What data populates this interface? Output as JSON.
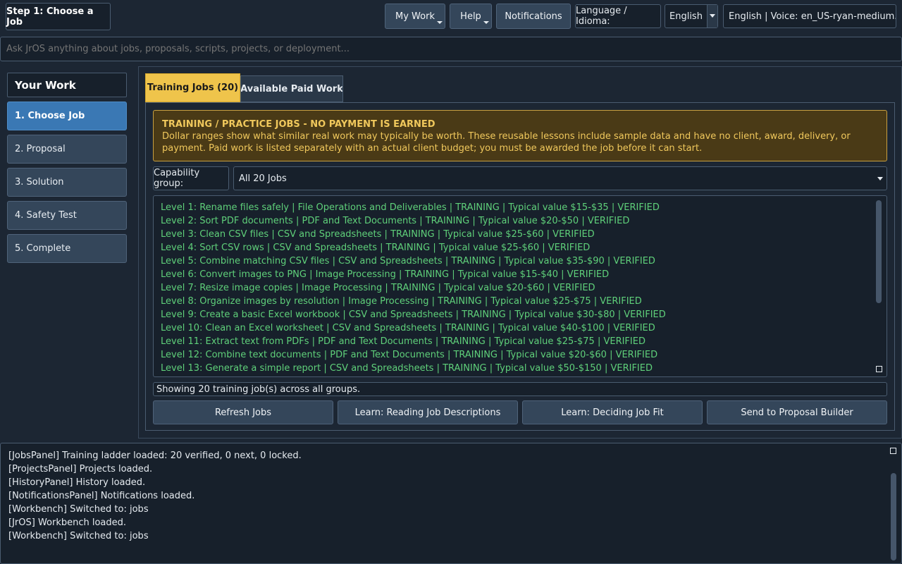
{
  "header": {
    "step_title": "Step 1: Choose a Job",
    "my_work_label": "My Work",
    "help_label": "Help",
    "notifications_label": "Notifications",
    "language_label": "Language / Idioma:",
    "language_value": "English",
    "voice_label": "English | Voice: en_US-ryan-medium.onnx"
  },
  "search": {
    "placeholder": "Ask JrOS anything about jobs, proposals, scripts, projects, or deployment..."
  },
  "sidebar": {
    "title": "Your Work",
    "items": [
      {
        "label": "1. Choose Job",
        "active": true
      },
      {
        "label": "2. Proposal"
      },
      {
        "label": "3. Solution"
      },
      {
        "label": "4. Safety Test"
      },
      {
        "label": "5. Complete"
      }
    ]
  },
  "tabs": {
    "training": "Training Jobs (20)",
    "paid": "Available Paid Work"
  },
  "warning": {
    "title": "TRAINING / PRACTICE JOBS - NO PAYMENT IS EARNED",
    "body": "Dollar ranges show what similar real work may typically be worth. These reusable lessons include sample data and have no client, award, delivery, or payment. Paid work is listed separately with an actual client budget; you must be awarded the job before it can start."
  },
  "filter": {
    "label": "Capability group:",
    "value": "All 20 Jobs"
  },
  "jobs": [
    "Level 1: Rename files safely | File Operations and Deliverables | TRAINING | Typical value $15-$35 | VERIFIED",
    "Level 2: Sort PDF documents | PDF and Text Documents | TRAINING | Typical value $20-$50 | VERIFIED",
    "Level 3: Clean CSV files | CSV and Spreadsheets | TRAINING | Typical value $25-$60 | VERIFIED",
    "Level 4: Sort CSV rows | CSV and Spreadsheets | TRAINING | Typical value $25-$60 | VERIFIED",
    "Level 5: Combine matching CSV files | CSV and Spreadsheets | TRAINING | Typical value $35-$90 | VERIFIED",
    "Level 6: Convert images to PNG | Image Processing | TRAINING | Typical value $15-$40 | VERIFIED",
    "Level 7: Resize image copies | Image Processing | TRAINING | Typical value $20-$60 | VERIFIED",
    "Level 8: Organize images by resolution | Image Processing | TRAINING | Typical value $25-$75 | VERIFIED",
    "Level 9: Create a basic Excel workbook | CSV and Spreadsheets | TRAINING | Typical value $30-$80 | VERIFIED",
    "Level 10: Clean an Excel worksheet | CSV and Spreadsheets | TRAINING | Typical value $40-$100 | VERIFIED",
    "Level 11: Extract text from PDFs | PDF and Text Documents | TRAINING | Typical value $25-$75 | VERIFIED",
    "Level 12: Combine text documents | PDF and Text Documents | TRAINING | Typical value $20-$60 | VERIFIED",
    "Level 13: Generate a simple report | CSV and Spreadsheets | TRAINING | Typical value $50-$150 | VERIFIED"
  ],
  "status": "Showing 20 training job(s) across all groups.",
  "actions": {
    "refresh": "Refresh Jobs",
    "learn_reading": "Learn: Reading Job Descriptions",
    "learn_fit": "Learn: Deciding Job Fit",
    "send": "Send to Proposal Builder"
  },
  "log": [
    "[JobsPanel] Training ladder loaded: 20 verified, 0 next, 0 locked.",
    "[ProjectsPanel] Projects loaded.",
    "[HistoryPanel] History loaded.",
    "[NotificationsPanel] Notifications loaded.",
    "[Workbench] Switched to: jobs",
    "[JrOS] Workbench loaded.",
    "[Workbench] Switched to: jobs"
  ],
  "colors": {
    "accent_active": "#3a78b4",
    "tab_active": "#efc44b",
    "warning_text": "#f0c85c",
    "job_text": "#5fd07a"
  }
}
